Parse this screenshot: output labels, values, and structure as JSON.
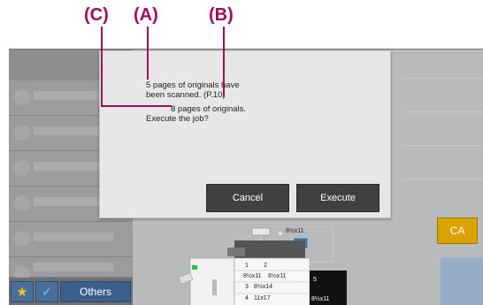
{
  "callouts": {
    "c": "(C)",
    "a": "(A)",
    "b": "(B)"
  },
  "dialog": {
    "line1": "5 pages of originals have",
    "line2": "been scanned. (P.10)",
    "line3": "8 pages of originals.",
    "line4": "Execute the job?",
    "cancel_label": "Cancel",
    "execute_label": "Execute"
  },
  "bottom_bar": {
    "others_label": "Others"
  },
  "right_panel": {
    "ca_label": "CA"
  },
  "machine": {
    "top_paper": "8½x11",
    "tray_1": "1",
    "tray_2": "2",
    "tray_3": "3",
    "tray_4": "4",
    "tray_5": "5",
    "tray_1_size": "8½x11",
    "tray_2_size": "8½x11",
    "tray_3_size": "8½x14",
    "tray_4_size": "11x17",
    "tray_5_size": "8½x11"
  },
  "colors": {
    "callout": "#a00b5a",
    "dialog_button": "#3f4041",
    "ca_button": "#d9a400",
    "others_button": "#3a5f8c"
  }
}
